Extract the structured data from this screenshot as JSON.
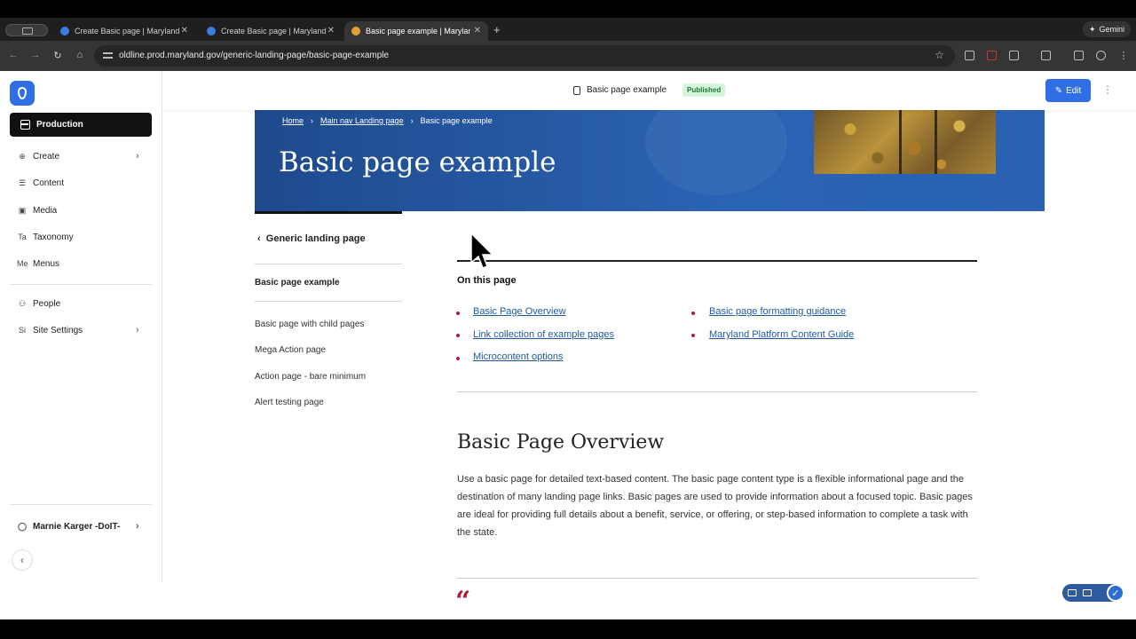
{
  "browser": {
    "tabs": [
      {
        "title": "Create Basic page | Maryland"
      },
      {
        "title": "Create Basic page | Maryland"
      },
      {
        "title": "Basic page example | Marylan"
      }
    ],
    "url": "oldline.prod.maryland.gov/generic-landing-page/basic-page-example",
    "gemini_label": "Gemini"
  },
  "sidebar": {
    "workspace": "Production",
    "items": [
      {
        "icon": "Ta",
        "label": "Taxonomy"
      },
      {
        "icon": "Me",
        "label": "Menus"
      },
      {
        "icon": "Si",
        "label": "Site Settings"
      }
    ],
    "create": "Create",
    "content": "Content",
    "media": "Media",
    "people": "People",
    "user": "Marnie Karger -DoIT-"
  },
  "header": {
    "page_name": "Basic page example",
    "status": "Published",
    "edit_label": "Edit"
  },
  "hero": {
    "breadcrumbs": [
      "Home",
      "Main nav Landing page",
      "Basic page example"
    ],
    "title": "Basic page example"
  },
  "left_nav": {
    "back_label": "Generic landing page",
    "current": "Basic page example",
    "items": [
      "Basic page with child pages",
      "Mega Action page",
      "Action page - bare minimum",
      "Alert testing page"
    ]
  },
  "on_this_page": {
    "heading": "On this page",
    "links": [
      "Basic Page Overview",
      "Link collection of example pages",
      "Microcontent options",
      "Basic page formatting guidance",
      "Maryland Platform Content Guide"
    ]
  },
  "section": {
    "heading": "Basic Page Overview",
    "paragraph": "Use a basic page for detailed text-based content. The basic page content type is a flexible informational page and the destination of many landing page links. Basic pages are used to provide information about a focused topic. Basic pages are ideal for providing full details about a benefit, service, or offering, or step-based information to complete a task with the state.",
    "quote_mark": "“"
  },
  "colors": {
    "accent": "#2f6ee5",
    "hero": "#2b63b4",
    "bullet": "#b01c3a",
    "link": "#1f5a9c",
    "published_bg": "#d6f5dc"
  }
}
